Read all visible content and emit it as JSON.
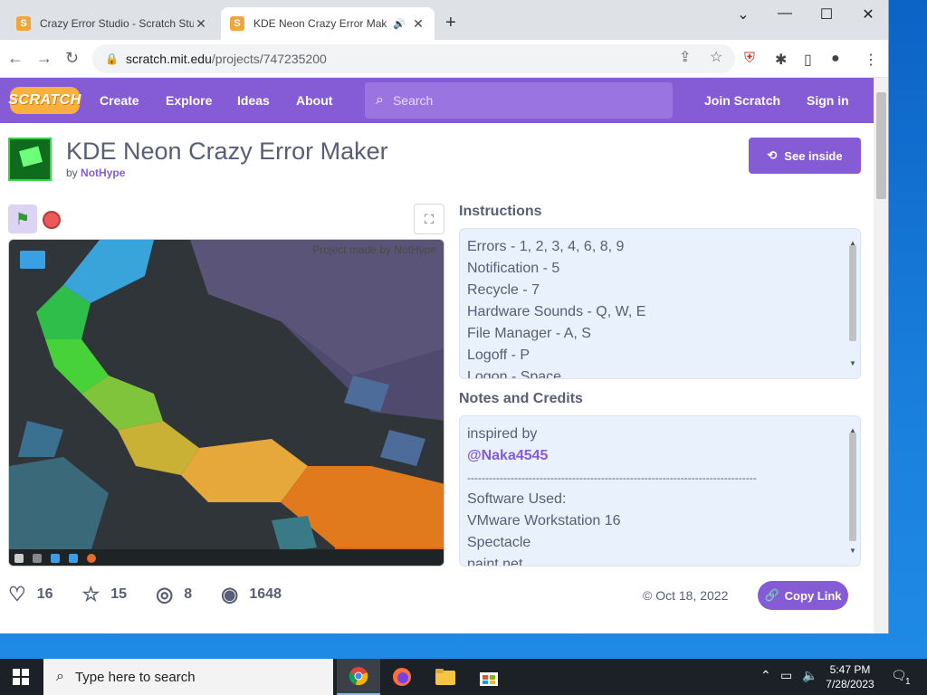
{
  "browser": {
    "tabs": [
      {
        "title": "Crazy Error Studio - Scratch Studio",
        "favicon": "S"
      },
      {
        "title": "KDE Neon Crazy Error Maker",
        "favicon": "S"
      }
    ],
    "new_tab": "+",
    "url_host": "scratch.mit.edu",
    "url_path": "/projects/747235200",
    "window_controls": [
      "⌄",
      "—",
      "☐",
      "✕"
    ]
  },
  "nav": {
    "logo": "SCRATCH",
    "links": [
      "Create",
      "Explore",
      "Ideas",
      "About"
    ],
    "search_placeholder": "Search",
    "join": "Join Scratch",
    "signin": "Sign in"
  },
  "project": {
    "title": "KDE Neon Crazy Error Maker",
    "by_label": "by",
    "author": "NotHype",
    "see_inside": "See inside",
    "stage_caption": "Project made by NotHype"
  },
  "instructions": {
    "heading": "Instructions",
    "lines": [
      "Errors - 1, 2, 3, 4, 6, 8, 9",
      "Notification - 5",
      "Recycle - 7",
      "Hardware Sounds - Q, W, E",
      "File Manager - A, S",
      "Logoff - P",
      "Logon - Space"
    ]
  },
  "notes": {
    "heading": "Notes and Credits",
    "inspired": "inspired by",
    "mention": "@Naka4545",
    "divider": "--------------------------------------------------------------------------------",
    "lines": [
      "Software Used:",
      "VMware Workstation 16",
      "Spectacle",
      "paint.net"
    ]
  },
  "stats": {
    "loves": "16",
    "favorites": "15",
    "remixes": "8",
    "views": "1648",
    "date": "Oct 18, 2022",
    "copy_link": "Copy Link"
  },
  "taskbar": {
    "search_placeholder": "Type here to search",
    "time": "5:47 PM",
    "date": "7/28/2023",
    "notification_count": "1"
  },
  "colors": {
    "scratch_purple": "#855cd6",
    "text_gray": "#575e75",
    "stop_red": "#ec5959"
  }
}
